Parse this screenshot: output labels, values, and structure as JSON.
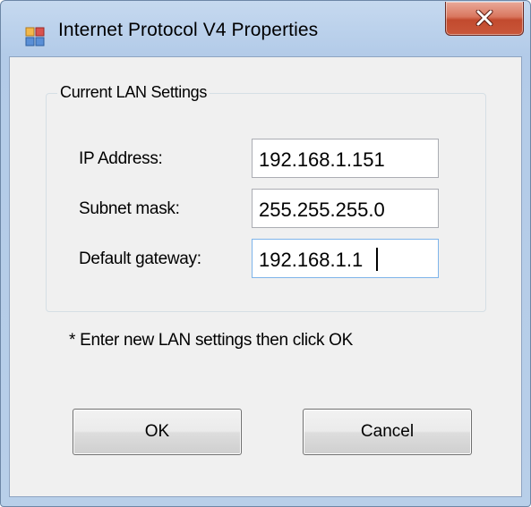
{
  "window": {
    "title": "Internet Protocol V4 Properties"
  },
  "group": {
    "title": "Current LAN Settings"
  },
  "fields": {
    "ip_address": {
      "label": "IP Address:",
      "value": "192.168.1.151"
    },
    "subnet_mask": {
      "label": "Subnet mask:",
      "value": "255.255.255.0"
    },
    "default_gateway": {
      "label": "Default gateway:",
      "value": "192.168.1.1"
    }
  },
  "hint": "* Enter new LAN settings then click OK",
  "buttons": {
    "ok": "OK",
    "cancel": "Cancel"
  },
  "icons": {
    "app": "network-properties-icon",
    "close": "close-icon"
  },
  "colors": {
    "titlebar": "#bcd2ec",
    "client_background": "#f0f0f0",
    "close_button": "#c9573a"
  }
}
